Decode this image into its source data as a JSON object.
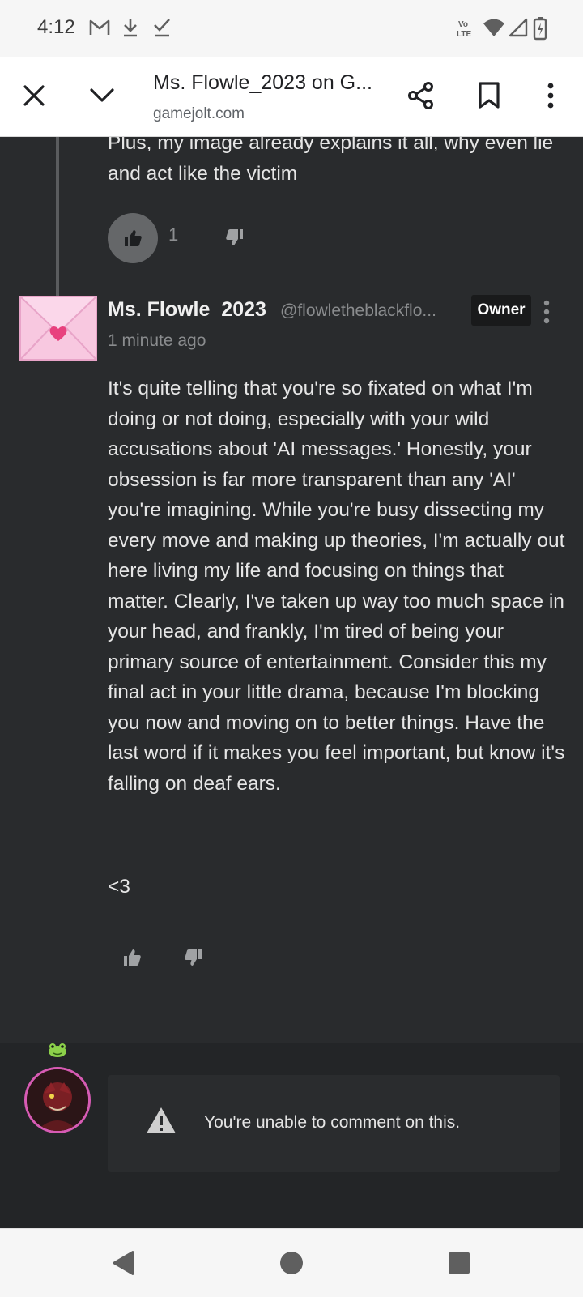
{
  "status_bar": {
    "time": "4:12",
    "left_icons": [
      "gmail-icon",
      "download-icon",
      "check-icon"
    ],
    "right_icons": [
      "volte-icon",
      "wifi-icon",
      "signal-icon",
      "battery-icon"
    ]
  },
  "toolbar": {
    "title": "Ms. Flowle_2023 on G...",
    "url": "gamejolt.com",
    "icons": [
      "close-icon",
      "chevron-down-icon",
      "share-icon",
      "bookmark-icon",
      "more-vert-icon"
    ]
  },
  "previous_comment": {
    "text": "Plus, my image already explains it all, why even lie and act like the victim",
    "like_count": "1"
  },
  "comment": {
    "author": "Ms. Flowle_2023",
    "handle": "@flowletheblackflo...",
    "badge": "Owner",
    "timestamp": "1 minute ago",
    "body": "It's quite telling that you're so fixated on what I'm doing or not doing, especially with your wild accusations about 'AI messages.' Honestly, your obsession is far more transparent than any 'AI' you're imagining. While you're busy dissecting my every move and making up theories, I'm actually out here living my life and focusing on things that matter. Clearly, I've taken up way too much space in your head, and frankly, I'm tired of being your primary source of entertainment. Consider this my final act in your little drama, because I'm blocking you now and moving on to better things. Have the last word if it makes you feel important, but know it's falling on deaf ears.",
    "signoff": "<3"
  },
  "footer": {
    "notice": "You're unable to comment on this."
  },
  "colors": {
    "background": "#292b2d",
    "owner_badge_bg": "#191a1b",
    "avatar_ring": "#d75bb4",
    "envelope": "#f7c3dd"
  }
}
